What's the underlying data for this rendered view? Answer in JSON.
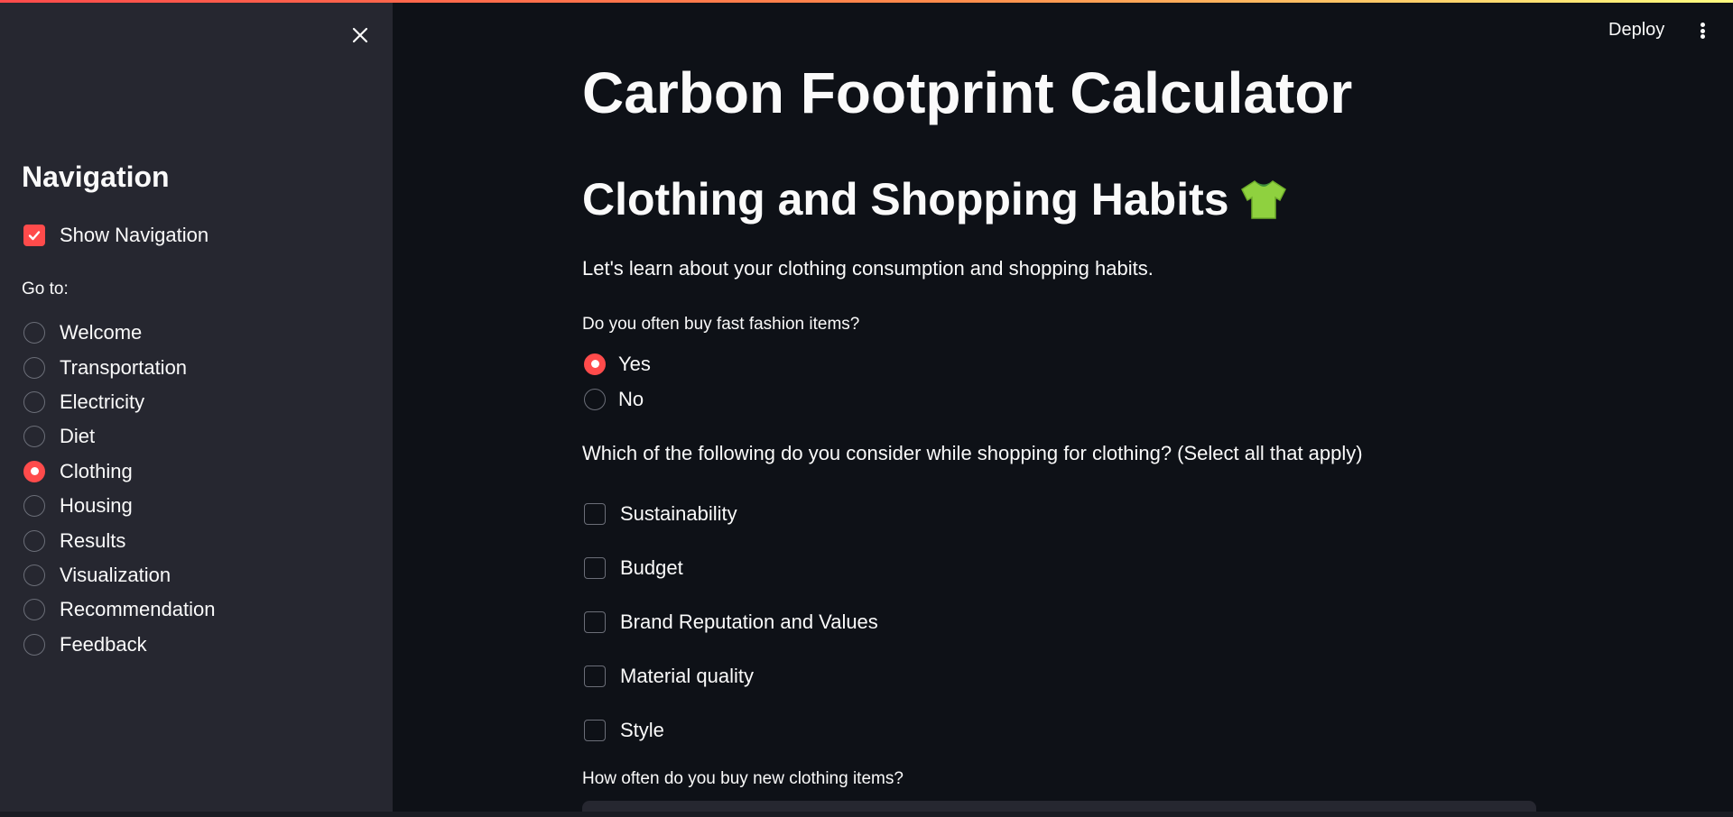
{
  "header": {
    "deploy_label": "Deploy"
  },
  "sidebar": {
    "title": "Navigation",
    "show_navigation_label": "Show Navigation",
    "show_navigation_checked": true,
    "goto_label": "Go to:",
    "items": [
      {
        "label": "Welcome",
        "selected": false
      },
      {
        "label": "Transportation",
        "selected": false
      },
      {
        "label": "Electricity",
        "selected": false
      },
      {
        "label": "Diet",
        "selected": false
      },
      {
        "label": "Clothing",
        "selected": true
      },
      {
        "label": "Housing",
        "selected": false
      },
      {
        "label": "Results",
        "selected": false
      },
      {
        "label": "Visualization",
        "selected": false
      },
      {
        "label": "Recommendation",
        "selected": false
      },
      {
        "label": "Feedback",
        "selected": false
      }
    ]
  },
  "main": {
    "page_title": "Carbon Footprint Calculator",
    "section_title": "Clothing and Shopping Habits",
    "section_icon": "t-shirt-icon",
    "intro": "Let's learn about your clothing consumption and shopping habits.",
    "q1": {
      "label": "Do you often buy fast fashion items?",
      "options": [
        {
          "label": "Yes",
          "selected": true
        },
        {
          "label": "No",
          "selected": false
        }
      ]
    },
    "q2": {
      "label": "Which of the following do you consider while shopping for clothing? (Select all that apply)",
      "options": [
        {
          "label": "Sustainability",
          "checked": false
        },
        {
          "label": "Budget",
          "checked": false
        },
        {
          "label": "Brand Reputation and Values",
          "checked": false
        },
        {
          "label": "Material quality",
          "checked": false
        },
        {
          "label": "Style",
          "checked": false
        }
      ]
    },
    "q3": {
      "label": "How often do you buy new clothing items?"
    }
  },
  "colors": {
    "accent": "#ff4b4b",
    "sidebar_bg": "#262730",
    "main_bg": "#0e1117"
  }
}
